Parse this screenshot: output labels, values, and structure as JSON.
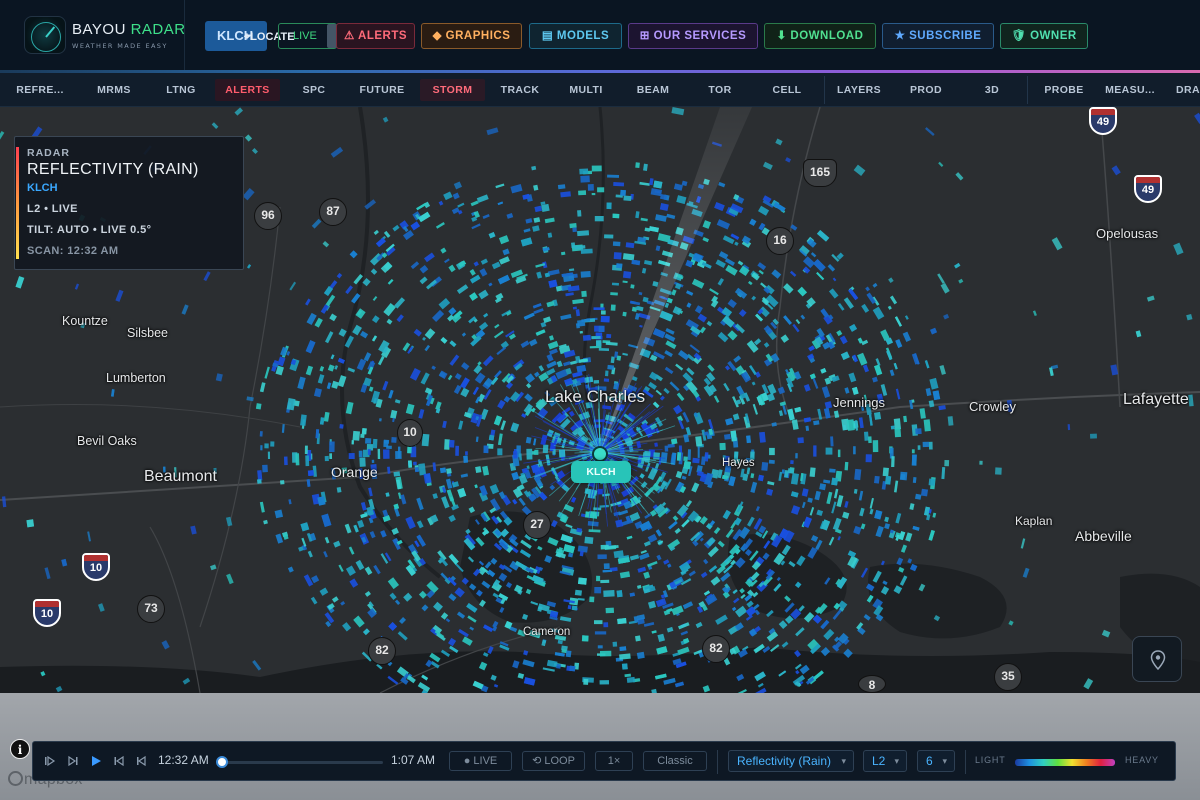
{
  "header": {
    "brand": {
      "name_part1": "BAYOU ",
      "name_part2": "RADAR",
      "tagline": "WEATHER MADE EASY"
    },
    "site_code": "KLCH",
    "locate_label": "LOCATE",
    "live_label": "LIVE",
    "nav": {
      "alerts": "⚠ ALERTS",
      "graphics": "◆ GRAPHICS",
      "models": "▤ MODELS",
      "services": "⊞ OUR SERVICES",
      "download": "⬇ DOWNLOAD",
      "subscribe": "★ SUBSCRIBE",
      "owner": "🛡 OWNER"
    }
  },
  "toolbar": {
    "items": [
      "REFRE...",
      "MRMS",
      "LTNG",
      "ALERTS",
      "SPC",
      "FUTURE",
      "STORM",
      "TRACK",
      "MULTI",
      "BEAM",
      "TOR",
      "CELL",
      "LAYERS",
      "PROD",
      "3D",
      "PROBE",
      "MEASU...",
      "DRA"
    ]
  },
  "info_card": {
    "label": "RADAR",
    "product": "REFLECTIVITY (RAIN)",
    "site": "KLCH",
    "level": "L2 • LIVE",
    "tilt": "TILT: AUTO • LIVE 0.5°",
    "scan": "SCAN: 12:32 AM"
  },
  "map": {
    "station_label": "KLCH",
    "cities": {
      "lake_charles": "Lake Charles",
      "beaumont": "Beaumont",
      "orange": "Orange",
      "kountze": "Kountze",
      "silsbee": "Silsbee",
      "lumberton": "Lumberton",
      "bevil_oaks": "Bevil Oaks",
      "jennings": "Jennings",
      "crowley": "Crowley",
      "lafayette": "Lafayette",
      "opelousas": "Opelousas",
      "hayes": "Hayes",
      "kaplan": "Kaplan",
      "abbeville": "Abbeville",
      "cameron": "Cameron"
    },
    "shields": {
      "s96": "96",
      "s87": "87",
      "s165": "165",
      "s16": "16",
      "s10a": "10",
      "s27": "27",
      "s73": "73",
      "s82a": "82",
      "s82b": "82",
      "s8": "8",
      "s35": "35",
      "i49a": "49",
      "i49b": "49",
      "i10a": "10",
      "i10b": "10"
    }
  },
  "controls": {
    "time_start": "12:32 AM",
    "time_end": "1:07 AM",
    "live": "LIVE",
    "loop": "LOOP",
    "speed": "1×",
    "style": "Classic",
    "product": "Reflectivity (Rain)",
    "level": "L2",
    "smoothing": "6",
    "legend_light": "LIGHT",
    "legend_heavy": "HEAVY"
  },
  "attribution": {
    "info": "i",
    "mapbox": "mapbox"
  },
  "colors": {
    "accent": "#3ee08a",
    "station": "#28c4b8",
    "radar_light": "#2ab0c8",
    "radar_heavy": "#1a40e0"
  }
}
